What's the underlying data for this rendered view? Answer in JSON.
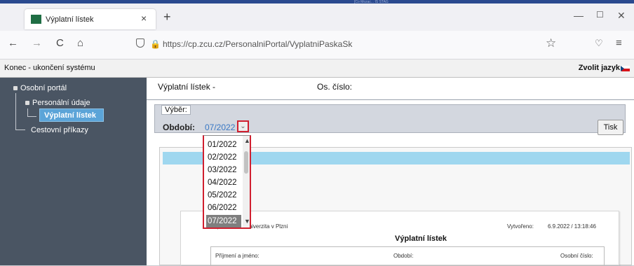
{
  "browser": {
    "top_partial_text": "[Co Mozac... IS STAG",
    "tab_title": "Výplatní lístek",
    "tab_close": "×",
    "new_tab": "+",
    "window_min": "—",
    "window_max": "☐",
    "window_close": "✕",
    "back": "←",
    "forward": "→",
    "reload": "C",
    "home": "⌂",
    "url": "https://cp.zcu.cz/PersonalniPortal/VyplatniPaskaSk",
    "url_lock": "🔒",
    "bookmark": "☆",
    "pocket": "♡",
    "menu": "≡"
  },
  "app_header": {
    "logout": "Konec - ukončení systému",
    "language": "Zvolit jazyk"
  },
  "sidebar": {
    "items": [
      {
        "label": "Osobní portál"
      },
      {
        "label": "Personální údaje"
      },
      {
        "label": "Výplatní lístek"
      },
      {
        "label": "Cestovní příkazy"
      }
    ]
  },
  "main": {
    "title": "Výplatní lístek -",
    "os_cislo_label": "Os. číslo:",
    "vyber_legend": "Výběr:",
    "obdobi_label": "Období:",
    "obdobi_value": "07/2022",
    "print_button": "Tisk"
  },
  "dropdown": {
    "options": [
      "01/2022",
      "02/2022",
      "03/2022",
      "04/2022",
      "05/2022",
      "06/2022",
      "07/2022"
    ],
    "selected": "07/2022"
  },
  "report": {
    "institution": "Západočeská univerzita v Plzni",
    "created_label": "Vytvořeno:",
    "created_value": "6.9.2022 / 13:18:46",
    "title": "Výplatní lístek",
    "col_name": "Příjmení a jméno:",
    "col_period": "Období:",
    "col_personal": "Osobní číslo:"
  },
  "colors": {
    "sidebar_bg": "#4a5563",
    "selected_bg": "#5ba4d8",
    "highlight_border": "#d01f2f",
    "link_blue": "#3a78c4"
  }
}
